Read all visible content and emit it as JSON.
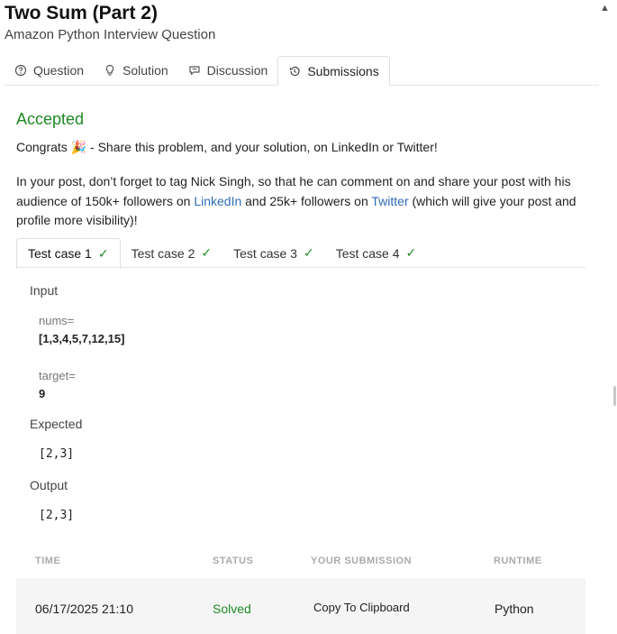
{
  "header": {
    "title": "Two Sum (Part 2)",
    "subtitle": "Amazon Python Interview Question"
  },
  "tabs": [
    {
      "label": "Question",
      "icon": "question-circle-icon"
    },
    {
      "label": "Solution",
      "icon": "lightbulb-icon"
    },
    {
      "label": "Discussion",
      "icon": "chat-bubble-icon"
    },
    {
      "label": "Submissions",
      "icon": "history-icon",
      "active": true
    }
  ],
  "result": {
    "status": "Accepted",
    "congrats_prefix": "Congrats",
    "congrats_emoji": "🎉",
    "congrats_text": "- Share this problem, and your solution, on LinkedIn or Twitter!",
    "note_part1": "In your post, don’t forget to tag Nick Singh, so that he can comment on and share your post with his audience of 150k+ followers on ",
    "linkedin_link": "LinkedIn",
    "note_part2": " and 25k+ followers on ",
    "twitter_link": "Twitter",
    "note_part3": " (which will give your post and profile more visibility)!"
  },
  "test_cases": [
    {
      "label": "Test case 1",
      "passed": true,
      "active": true
    },
    {
      "label": "Test case 2",
      "passed": true
    },
    {
      "label": "Test case 3",
      "passed": true
    },
    {
      "label": "Test case 4",
      "passed": true
    }
  ],
  "case_detail": {
    "input_label": "Input",
    "params": [
      {
        "name": "nums=",
        "value": "[1,3,4,5,7,12,15]"
      },
      {
        "name": "target=",
        "value": "9"
      }
    ],
    "expected_label": "Expected",
    "expected_value": "[2,3]",
    "output_label": "Output",
    "output_value": "[2,3]"
  },
  "submissions": {
    "columns": [
      "TIME",
      "STATUS",
      "YOUR SUBMISSION",
      "RUNTIME"
    ],
    "rows": [
      {
        "time": "06/17/2025 21:10",
        "status": "Solved",
        "submission": "Copy To Clipboard",
        "runtime": "Python"
      }
    ]
  },
  "colors": {
    "accent_green": "#1e8a24",
    "link_blue": "#2f6db5"
  }
}
